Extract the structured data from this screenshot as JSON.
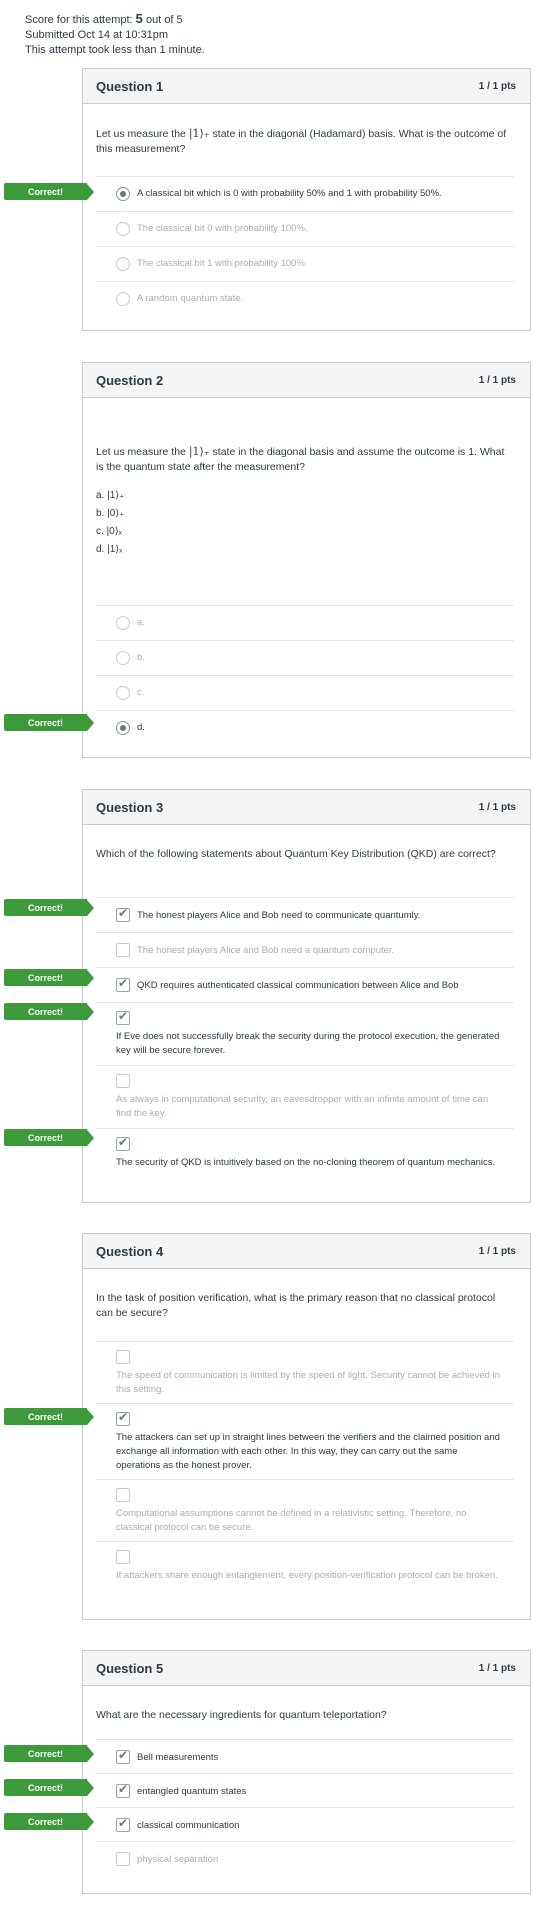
{
  "summary": {
    "score_prefix": "Score for this attempt:",
    "score_value": "5",
    "score_suffix": "out of 5",
    "submitted": "Submitted Oct 14 at 10:31pm",
    "duration": "This attempt took less than 1 minute."
  },
  "correct_label": "Correct!",
  "questions": [
    {
      "title": "Question 1",
      "points": "1 / 1 pts",
      "text_a": "Let us measure the ",
      "ket": "|1⟩₊",
      "text_b": " state in the diagonal (Hadamard) basis. What is the outcome of this measurement?",
      "answers": [
        {
          "text": "A classical bit which is 0 with probability 50% and 1 with probability 50%.",
          "selected": true
        },
        {
          "text": "The classical bit 0 with probability 100%.",
          "selected": false
        },
        {
          "text": "The classical bit 1 with probability 100%",
          "selected": false
        },
        {
          "text": "A random quantum state.",
          "selected": false
        }
      ]
    },
    {
      "title": "Question 2",
      "points": "1 / 1 pts",
      "text_a": "Let us measure the ",
      "ket": "|1⟩₊",
      "text_b": " state in the diagonal basis and assume the outcome is 1. What is the quantum state after the measurement?",
      "options": [
        "a. |1⟩₊",
        "b. |0⟩₊",
        "c. |0⟩ₓ",
        "d. |1⟩ₓ"
      ],
      "answers": [
        {
          "text": "a.",
          "selected": false
        },
        {
          "text": "b.",
          "selected": false
        },
        {
          "text": "c.",
          "selected": false
        },
        {
          "text": "d.",
          "selected": true
        }
      ]
    },
    {
      "title": "Question 3",
      "points": "1 / 1 pts",
      "text": "Which of the following statements about Quantum Key Distribution (QKD) are correct?",
      "answers": [
        {
          "text": "The honest players Alice and Bob need to communicate quantumly.",
          "selected": true
        },
        {
          "text": "The honest players Alice and Bob need a quantum computer.",
          "selected": false
        },
        {
          "text": "QKD requires authenticated classical communication between Alice and Bob",
          "selected": true
        },
        {
          "text": "If Eve does not successfully break the security during the protocol execution, the generated key will be secure forever.",
          "selected": true
        },
        {
          "text": "As always in computational security, an eavesdropper with an infinite amount of time can find the key.",
          "selected": false
        },
        {
          "text": "The security of QKD is intuitively based on the no-cloning theorem of quantum mechanics.",
          "selected": true
        }
      ]
    },
    {
      "title": "Question 4",
      "points": "1 / 1 pts",
      "text": "In the task of position verification, what is the primary reason that no classical protocol can be secure?",
      "answers": [
        {
          "text": "The speed of communication is limited by the speed of light. Security cannot be achieved in this setting.",
          "selected": false
        },
        {
          "text": "The attackers can set up in straight lines between the verifiers and the claimed position and exchange all information with each other. In this way, they can carry out the same operations as the honest prover.",
          "selected": true
        },
        {
          "text": "Computational assumptions cannot be defined in a relativistic setting. Therefore, no classical protocol can be secure.",
          "selected": false
        },
        {
          "text": "If attackers share enough entanglement, every position-verification protocol can be broken.",
          "selected": false
        }
      ]
    },
    {
      "title": "Question 5",
      "points": "1 / 1 pts",
      "text": "What are the necessary ingredients for quantum teleportation?",
      "answers": [
        {
          "text": "Bell measurements",
          "selected": true
        },
        {
          "text": "entangled quantum states",
          "selected": true
        },
        {
          "text": "classical communication",
          "selected": true
        },
        {
          "text": "physical separation",
          "selected": false
        }
      ]
    }
  ],
  "colors": {
    "correct_flag": "#3d9a3a",
    "header_bg": "#f5f5f5",
    "border": "#c7cdd1"
  }
}
